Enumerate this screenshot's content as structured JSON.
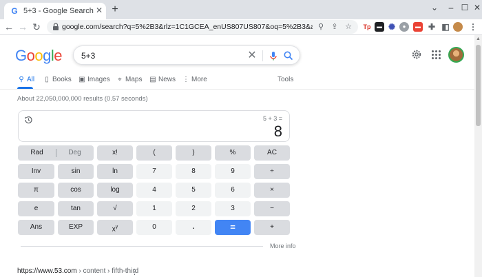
{
  "browser": {
    "tab_title": "5+3 - Google Search",
    "tab_favicon": "G",
    "url": "google.com/search?q=5%2B3&rlz=1C1GCEA_enUS807US807&oq=5%2B3&aqs=chrome..69i57j..."
  },
  "google": {
    "logo_letters": [
      "G",
      "o",
      "o",
      "g",
      "l",
      "e"
    ],
    "logo_colors": [
      "#4285f4",
      "#ea4335",
      "#fbbc05",
      "#4285f4",
      "#34a853",
      "#ea4335"
    ],
    "query": "5+3",
    "tabs": [
      {
        "label": "All",
        "icon": "search-icon"
      },
      {
        "label": "Books",
        "icon": "book-icon"
      },
      {
        "label": "Images",
        "icon": "image-icon"
      },
      {
        "label": "Maps",
        "icon": "map-pin-icon"
      },
      {
        "label": "News",
        "icon": "news-icon"
      },
      {
        "label": "More",
        "icon": "kebab-icon"
      }
    ],
    "tools_label": "Tools",
    "result_stats": "About 22,050,000,000 results (0.57 seconds)"
  },
  "calculator": {
    "expression": "5 + 3 =",
    "result": "8",
    "keys": {
      "rad": "Rad",
      "deg": "Deg",
      "fact": "x!",
      "lparen": "(",
      "rparen": ")",
      "percent": "%",
      "ac": "AC",
      "inv": "Inv",
      "sin": "sin",
      "ln": "ln",
      "seven": "7",
      "eight": "8",
      "nine": "9",
      "divide": "÷",
      "pi": "π",
      "cos": "cos",
      "log": "log",
      "four": "4",
      "five": "5",
      "six": "6",
      "multiply": "×",
      "e": "e",
      "tan": "tan",
      "sqrt": "√",
      "one": "1",
      "two": "2",
      "three": "3",
      "minus": "−",
      "ans": "Ans",
      "exp": "EXP",
      "pow_base": "x",
      "pow_exp": "y",
      "zero": "0",
      "dot": ".",
      "equals": "=",
      "plus": "+"
    },
    "more_info": "More info"
  },
  "result_cite": {
    "site": "https://www.53.com",
    "path": " › content › fifth-third"
  }
}
